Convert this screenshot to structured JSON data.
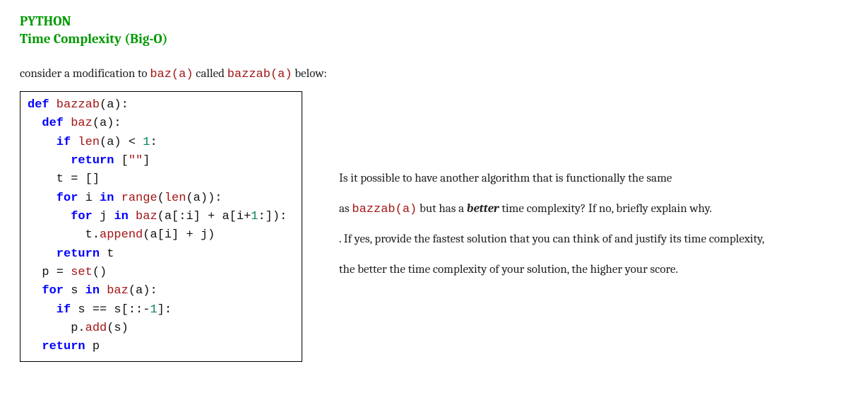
{
  "heading": "PYTHON",
  "subheading": "Time Complexity (Big-O)",
  "intro": {
    "pre": "consider a modification to ",
    "code1": "baz(a)",
    "mid": " called ",
    "code2": "bazzab(a)",
    "post": " below:"
  },
  "code": {
    "l1a": "def",
    "l1b": " bazzab",
    "l1c": "(a):",
    "l2a": "  def",
    "l2b": " baz",
    "l2c": "(a):",
    "l3a": "    if",
    "l3b": " len",
    "l3c": "(a) < ",
    "l3d": "1",
    "l3e": ":",
    "l4a": "      return",
    "l4b": " [",
    "l4c": "\"\"",
    "l4d": "]",
    "l5": "    t = []",
    "l6a": "    for",
    "l6b": " i ",
    "l6c": "in",
    "l6d": " range",
    "l6e": "(",
    "l6f": "len",
    "l6g": "(a)):",
    "l7a": "      for",
    "l7b": " j ",
    "l7c": "in",
    "l7d": " baz",
    "l7e": "(a[:i] + a[i+",
    "l7f": "1",
    "l7g": ":]):",
    "l8a": "        t.",
    "l8b": "append",
    "l8c": "(a[i] + j)",
    "l9a": "    return",
    "l9b": " t",
    "l10a": "  p = ",
    "l10b": "set",
    "l10c": "()",
    "l11a": "  for",
    "l11b": " s ",
    "l11c": "in",
    "l11d": " baz",
    "l11e": "(a):",
    "l12a": "    if",
    "l12b": " s == s[::-",
    "l12c": "1",
    "l12d": "]:",
    "l13a": "      p.",
    "l13b": "add",
    "l13c": "(s)",
    "l14a": "  return",
    "l14b": " p"
  },
  "q": {
    "p1a": "Is it possible to have another algorithm that is functionally the same",
    "p2a": "as ",
    "p2code": "bazzab(a)",
    "p2b": " but has a ",
    "p2bold": "better",
    "p2c": " time complexity? If no, briefly explain why.",
    "p3lead": ". ",
    "p3": "If yes, provide the fastest solution that you can think of and justify its time complexity,",
    "p4": "the better the time complexity of your solution, the higher your score."
  }
}
